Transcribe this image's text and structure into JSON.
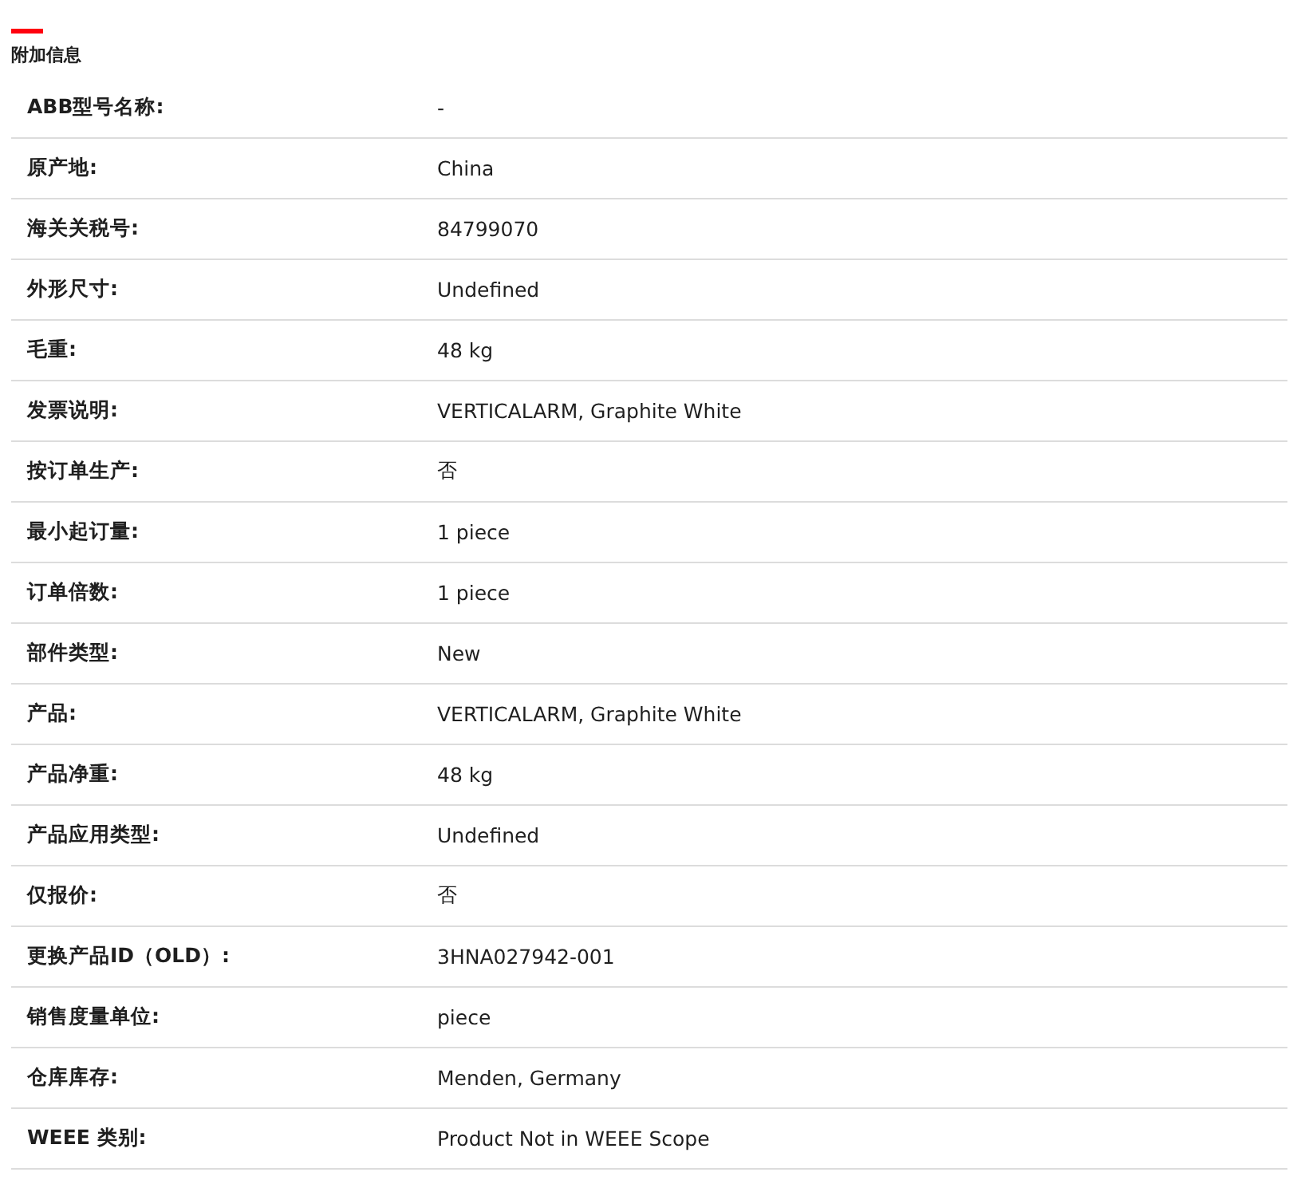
{
  "section": {
    "title": "附加信息"
  },
  "rows": [
    {
      "label": "ABB型号名称:",
      "value": "-"
    },
    {
      "label": "原产地:",
      "value": "China"
    },
    {
      "label": "海关关税号:",
      "value": "84799070"
    },
    {
      "label": "外形尺寸:",
      "value": "Undefined"
    },
    {
      "label": "毛重:",
      "value": "48 kg"
    },
    {
      "label": "发票说明:",
      "value": "VERTICALARM, Graphite White"
    },
    {
      "label": "按订单生产:",
      "value": "否"
    },
    {
      "label": "最小起订量:",
      "value": "1 piece"
    },
    {
      "label": "订单倍数:",
      "value": "1 piece"
    },
    {
      "label": "部件类型:",
      "value": "New"
    },
    {
      "label": "产品:",
      "value": "VERTICALARM, Graphite White"
    },
    {
      "label": "产品净重:",
      "value": "48 kg"
    },
    {
      "label": "产品应用类型:",
      "value": "Undefined"
    },
    {
      "label": "仅报价:",
      "value": "否"
    },
    {
      "label": "更换产品ID（OLD）:",
      "value": "3HNA027942-001"
    },
    {
      "label": "销售度量单位:",
      "value": "piece"
    },
    {
      "label": "仓库库存:",
      "value": "Menden, Germany"
    },
    {
      "label": "WEEE 类别:",
      "value": "Product Not in WEEE Scope"
    }
  ]
}
